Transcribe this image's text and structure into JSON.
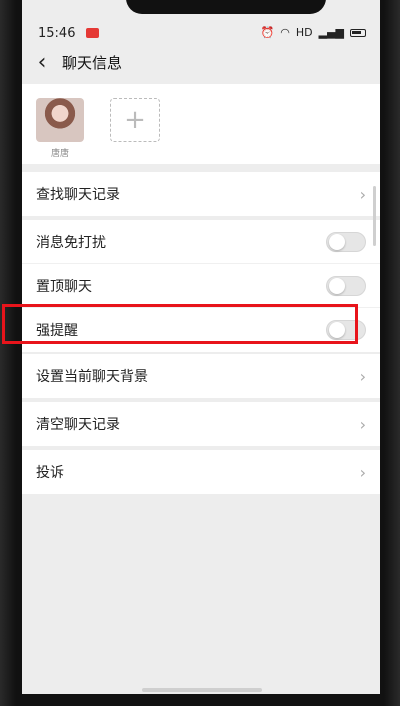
{
  "status": {
    "time": "15:46",
    "network": "HD"
  },
  "header": {
    "title": "聊天信息"
  },
  "member": {
    "name": "唐唐"
  },
  "menu": {
    "find_history": "查找聊天记录",
    "mute": "消息免打扰",
    "pin": "置顶聊天",
    "strong_reminder": "强提醒",
    "background": "设置当前聊天背景",
    "clear_history": "清空聊天记录",
    "complain": "投诉"
  },
  "colors": {
    "highlight": "#e8141b",
    "page_bg": "#ededed"
  },
  "toggles": {
    "mute": false,
    "pin": false,
    "strong_reminder": false
  }
}
